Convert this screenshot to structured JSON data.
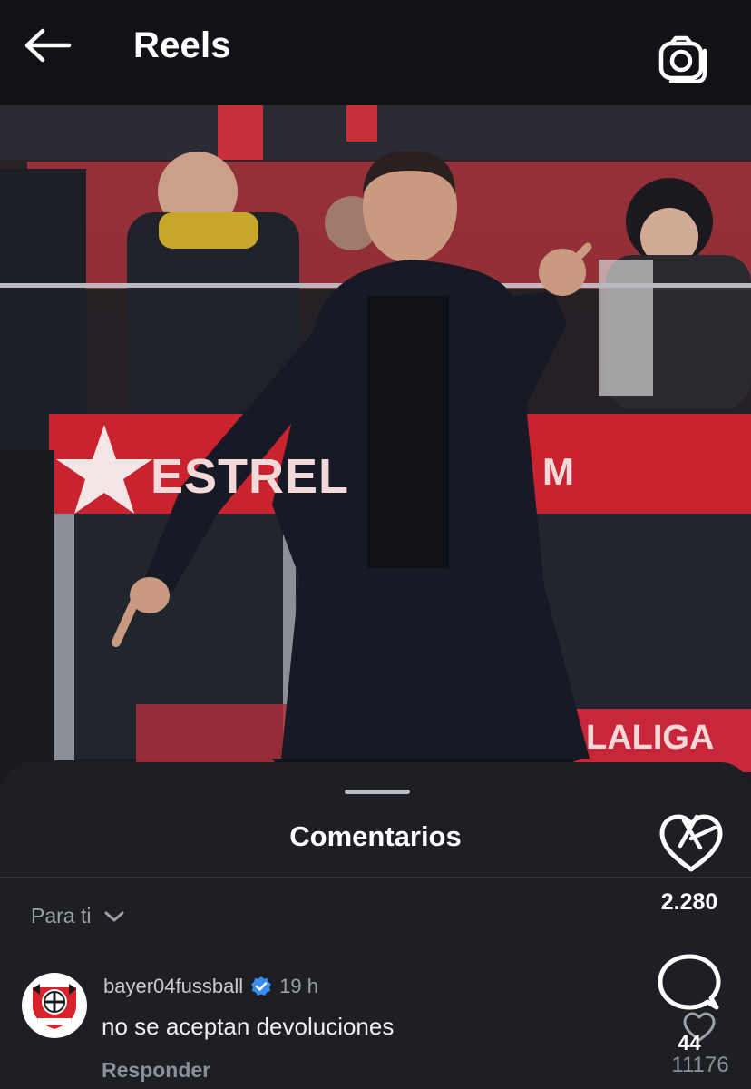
{
  "header": {
    "title": "Reels",
    "back_icon": "arrow-left-icon",
    "camera_icon": "camera-icon"
  },
  "video": {
    "banner_left_text": "ESTREL",
    "banner_right_text": "M",
    "laliga_text": "LALIGA"
  },
  "sheet": {
    "title": "Comentarios",
    "filter_label": "Para ti",
    "filter_icon": "chevron-down-icon"
  },
  "comment": {
    "username": "bayer04fussball",
    "verified_icon": "verified-badge-icon",
    "timestamp": "19 h",
    "text": "no se aceptan devoluciones",
    "reply_label": "Responder",
    "like_count": "11176"
  },
  "rail": {
    "like_count": "2.280",
    "comment_count": "44"
  },
  "colors": {
    "header_bg": "#111216",
    "sheet_bg": "#1e1f24",
    "verified": "#3b8cf0",
    "muted_text": "#9ea0a8"
  }
}
